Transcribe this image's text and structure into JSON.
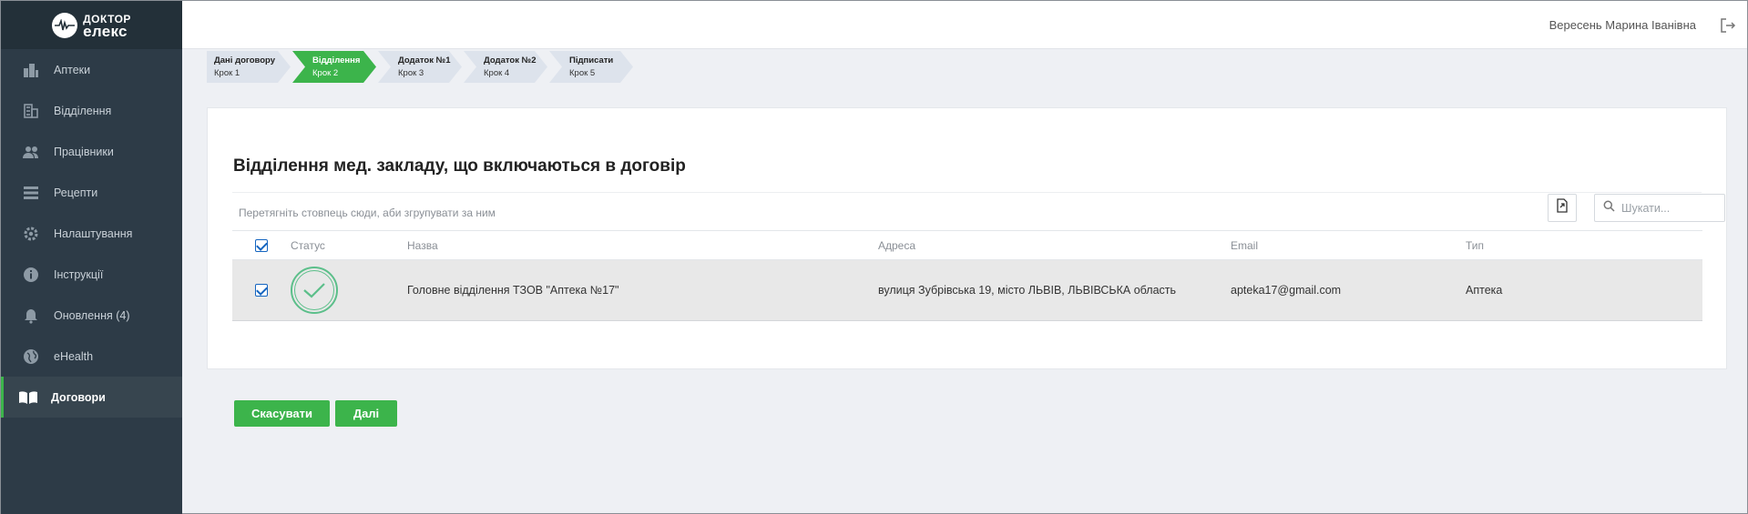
{
  "logo": {
    "line1": "ДОКТОР",
    "line2": "елекс"
  },
  "sidebar": {
    "items": [
      {
        "label": "Аптеки",
        "icon": "building-icon"
      },
      {
        "label": "Відділення",
        "icon": "office-icon"
      },
      {
        "label": "Працівники",
        "icon": "people-icon"
      },
      {
        "label": "Рецепти",
        "icon": "list-icon"
      },
      {
        "label": "Налаштування",
        "icon": "gear-icon"
      },
      {
        "label": "Інструкції",
        "icon": "info-icon"
      },
      {
        "label": "Оновлення (4)",
        "icon": "bell-icon"
      },
      {
        "label": "eHealth",
        "icon": "globe-icon"
      },
      {
        "label": "Договори",
        "icon": "book-icon",
        "active": true
      }
    ]
  },
  "header": {
    "user_name": "Вересень Марина Іванівна"
  },
  "steps": [
    {
      "title": "Дані договору",
      "sub": "Крок 1"
    },
    {
      "title": "Відділення",
      "sub": "Крок 2",
      "active": true
    },
    {
      "title": "Додаток №1",
      "sub": "Крок 3"
    },
    {
      "title": "Додаток №2",
      "sub": "Крок 4"
    },
    {
      "title": "Підписати",
      "sub": "Крок 5"
    }
  ],
  "main": {
    "title": "Відділення мед. закладу, що включаються в договір",
    "group_hint": "Перетягніть стовпець сюди, аби згрупувати за ним",
    "search_placeholder": "Шукати...",
    "columns": {
      "status": "Статус",
      "name": "Назва",
      "address": "Адреса",
      "email": "Email",
      "type": "Тип"
    },
    "rows": [
      {
        "checked": true,
        "name": "Головне відділення ТЗОВ \"Аптека №17\"",
        "address": "вулиця Зубрівська 19, місто ЛЬВІВ, ЛЬВІВСЬКА область",
        "email": "apteka17@gmail.com",
        "type": "Аптека"
      }
    ]
  },
  "buttons": {
    "cancel": "Скасувати",
    "next": "Далі"
  },
  "colors": {
    "sidebar": "#2d3b47",
    "accent": "#3cb44b",
    "checkbox": "#1565c0"
  }
}
